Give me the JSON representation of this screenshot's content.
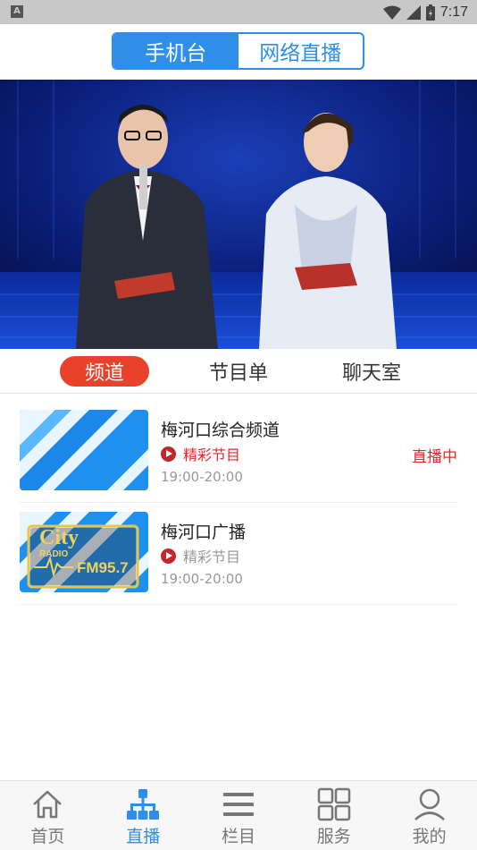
{
  "status_bar": {
    "time": "7:17",
    "notification_badge": "A"
  },
  "header": {
    "segments": [
      {
        "label": "手机台",
        "active": true
      },
      {
        "label": "网络直播",
        "active": false
      }
    ]
  },
  "tabs": [
    {
      "label": "频道",
      "active": true
    },
    {
      "label": "节目单",
      "active": false
    },
    {
      "label": "聊天室",
      "active": false
    }
  ],
  "channels": [
    {
      "name": "梅河口综合频道",
      "program": "精彩节目",
      "time": "19:00-20:00",
      "live": "直播中",
      "thumb_icon": "blue-stripes-logo"
    },
    {
      "name": "梅河口广播",
      "program": "精彩节目",
      "time": "19:00-20:00",
      "live": "",
      "thumb_icon": "city-radio-logo"
    }
  ],
  "city_logo": {
    "line1": "City",
    "line2": "RADIO",
    "line3": "FM95.7"
  },
  "bottom_nav": [
    {
      "label": "首页",
      "icon": "home-icon",
      "active": false
    },
    {
      "label": "直播",
      "icon": "live-network-icon",
      "active": true
    },
    {
      "label": "栏目",
      "icon": "menu-icon",
      "active": false
    },
    {
      "label": "服务",
      "icon": "grid-icon",
      "active": false
    },
    {
      "label": "我的",
      "icon": "user-icon",
      "active": false
    }
  ],
  "colors": {
    "accent_blue": "#2f8fe8",
    "tab_red": "#e8432a",
    "live_red": "#e02929",
    "program_red": "#c4262d"
  }
}
